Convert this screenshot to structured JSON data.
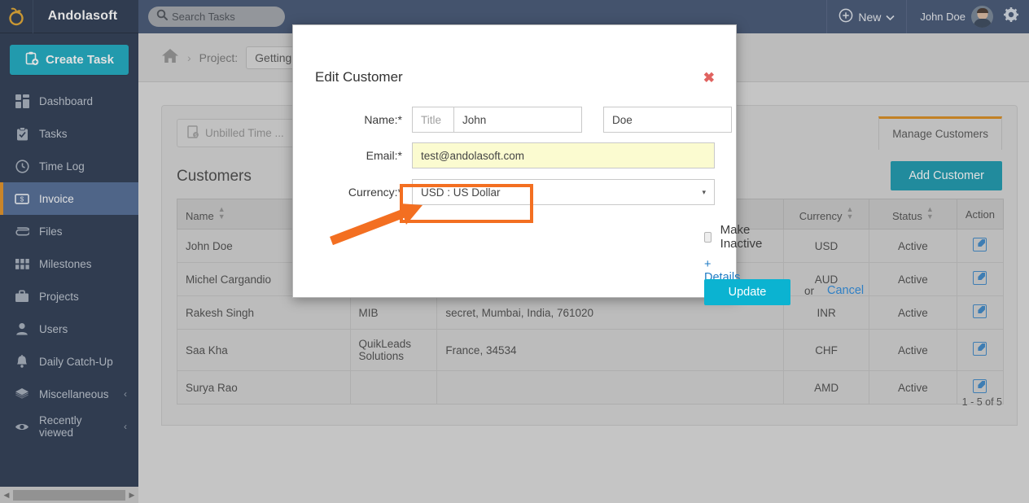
{
  "brand": {
    "name": "Andolasoft",
    "logo_icon": "orange-fruit-logo-icon"
  },
  "topbar": {
    "search": {
      "placeholder": "Search Tasks",
      "value": "",
      "icon": "search-icon"
    },
    "new_button": {
      "label": "New",
      "icon": "plus-circle-icon",
      "caret": "chevron-down-icon"
    },
    "user": {
      "name": "John Doe",
      "avatar_icon": "user-avatar"
    },
    "settings_icon": "gear-icon"
  },
  "sidebar": {
    "create_task": {
      "label": "Create Task",
      "icon": "clipboard-plus-icon"
    },
    "items": [
      {
        "label": "Dashboard",
        "icon": "dashboard-grid-icon",
        "active": false,
        "chevron": ""
      },
      {
        "label": "Tasks",
        "icon": "clipboard-check-icon",
        "active": false,
        "chevron": ""
      },
      {
        "label": "Time Log",
        "icon": "clock-icon",
        "active": false,
        "chevron": ""
      },
      {
        "label": "Invoice",
        "icon": "invoice-dollar-icon",
        "active": true,
        "chevron": ""
      },
      {
        "label": "Files",
        "icon": "paperclip-icon",
        "active": false,
        "chevron": ""
      },
      {
        "label": "Milestones",
        "icon": "grid-squares-icon",
        "active": false,
        "chevron": ""
      },
      {
        "label": "Projects",
        "icon": "briefcase-icon",
        "active": false,
        "chevron": ""
      },
      {
        "label": "Users",
        "icon": "person-icon",
        "active": false,
        "chevron": ""
      },
      {
        "label": "Daily Catch-Up",
        "icon": "bell-icon",
        "active": false,
        "chevron": ""
      },
      {
        "label": "Miscellaneous",
        "icon": "layers-icon",
        "active": false,
        "chevron": "‹"
      },
      {
        "label": "Recently viewed",
        "icon": "eye-icon",
        "active": false,
        "chevron": "‹"
      }
    ]
  },
  "breadcrumb": {
    "home_icon": "home-icon",
    "separator": "›",
    "label": "Project:",
    "chip": "Getting"
  },
  "panel": {
    "filter": {
      "label": "Unbilled Time  ...",
      "icon": "invoice-page-icon"
    },
    "tab": "Manage Customers",
    "title": "Customers",
    "add_button": "Add Customer",
    "pager": "1 - 5 of 5",
    "columns": [
      {
        "label": "Name",
        "sortable": true
      },
      {
        "label": "",
        "sortable": false
      },
      {
        "label": "",
        "sortable": false
      },
      {
        "label": "Currency",
        "sortable": true
      },
      {
        "label": "Status",
        "sortable": true
      },
      {
        "label": "Action",
        "sortable": false
      }
    ],
    "rows": [
      {
        "name": "John Doe",
        "company": "",
        "address": "",
        "currency": "USD",
        "status": "Active",
        "action_icon": "edit-icon"
      },
      {
        "name": "Michel Cargandio",
        "company": "",
        "address": "",
        "currency": "AUD",
        "status": "Active",
        "action_icon": "edit-icon"
      },
      {
        "name": "Rakesh Singh",
        "company": "MIB",
        "address": "secret, Mumbai, India, 761020",
        "currency": "INR",
        "status": "Active",
        "action_icon": "edit-icon"
      },
      {
        "name": "Saa Kha",
        "company": "QuikLeads Solutions",
        "address": "France, 34534",
        "currency": "CHF",
        "status": "Active",
        "action_icon": "edit-icon"
      },
      {
        "name": "Surya Rao",
        "company": "",
        "address": "",
        "currency": "AMD",
        "status": "Active",
        "action_icon": "edit-icon"
      }
    ]
  },
  "modal": {
    "title": "Edit Customer",
    "close_icon": "close-x-icon",
    "name_label": "Name:*",
    "title_placeholder": "Title",
    "title_value": "",
    "first_name": "John",
    "last_name": "Doe",
    "email_label": "Email:*",
    "email_value": "test@andolasoft.com",
    "currency_label": "Currency:*",
    "currency_value": "USD : US Dollar",
    "currency_caret": "▾",
    "make_inactive_label": "Make Inactive",
    "make_inactive_checked": false,
    "details_link": "+ Details",
    "update_button": "Update",
    "or_text": "or",
    "cancel_link": "Cancel"
  },
  "annotation": {
    "color": "#f36f21",
    "highlight_target": "make-inactive-checkbox",
    "arrow_icon": "pointer-arrow-icon"
  }
}
